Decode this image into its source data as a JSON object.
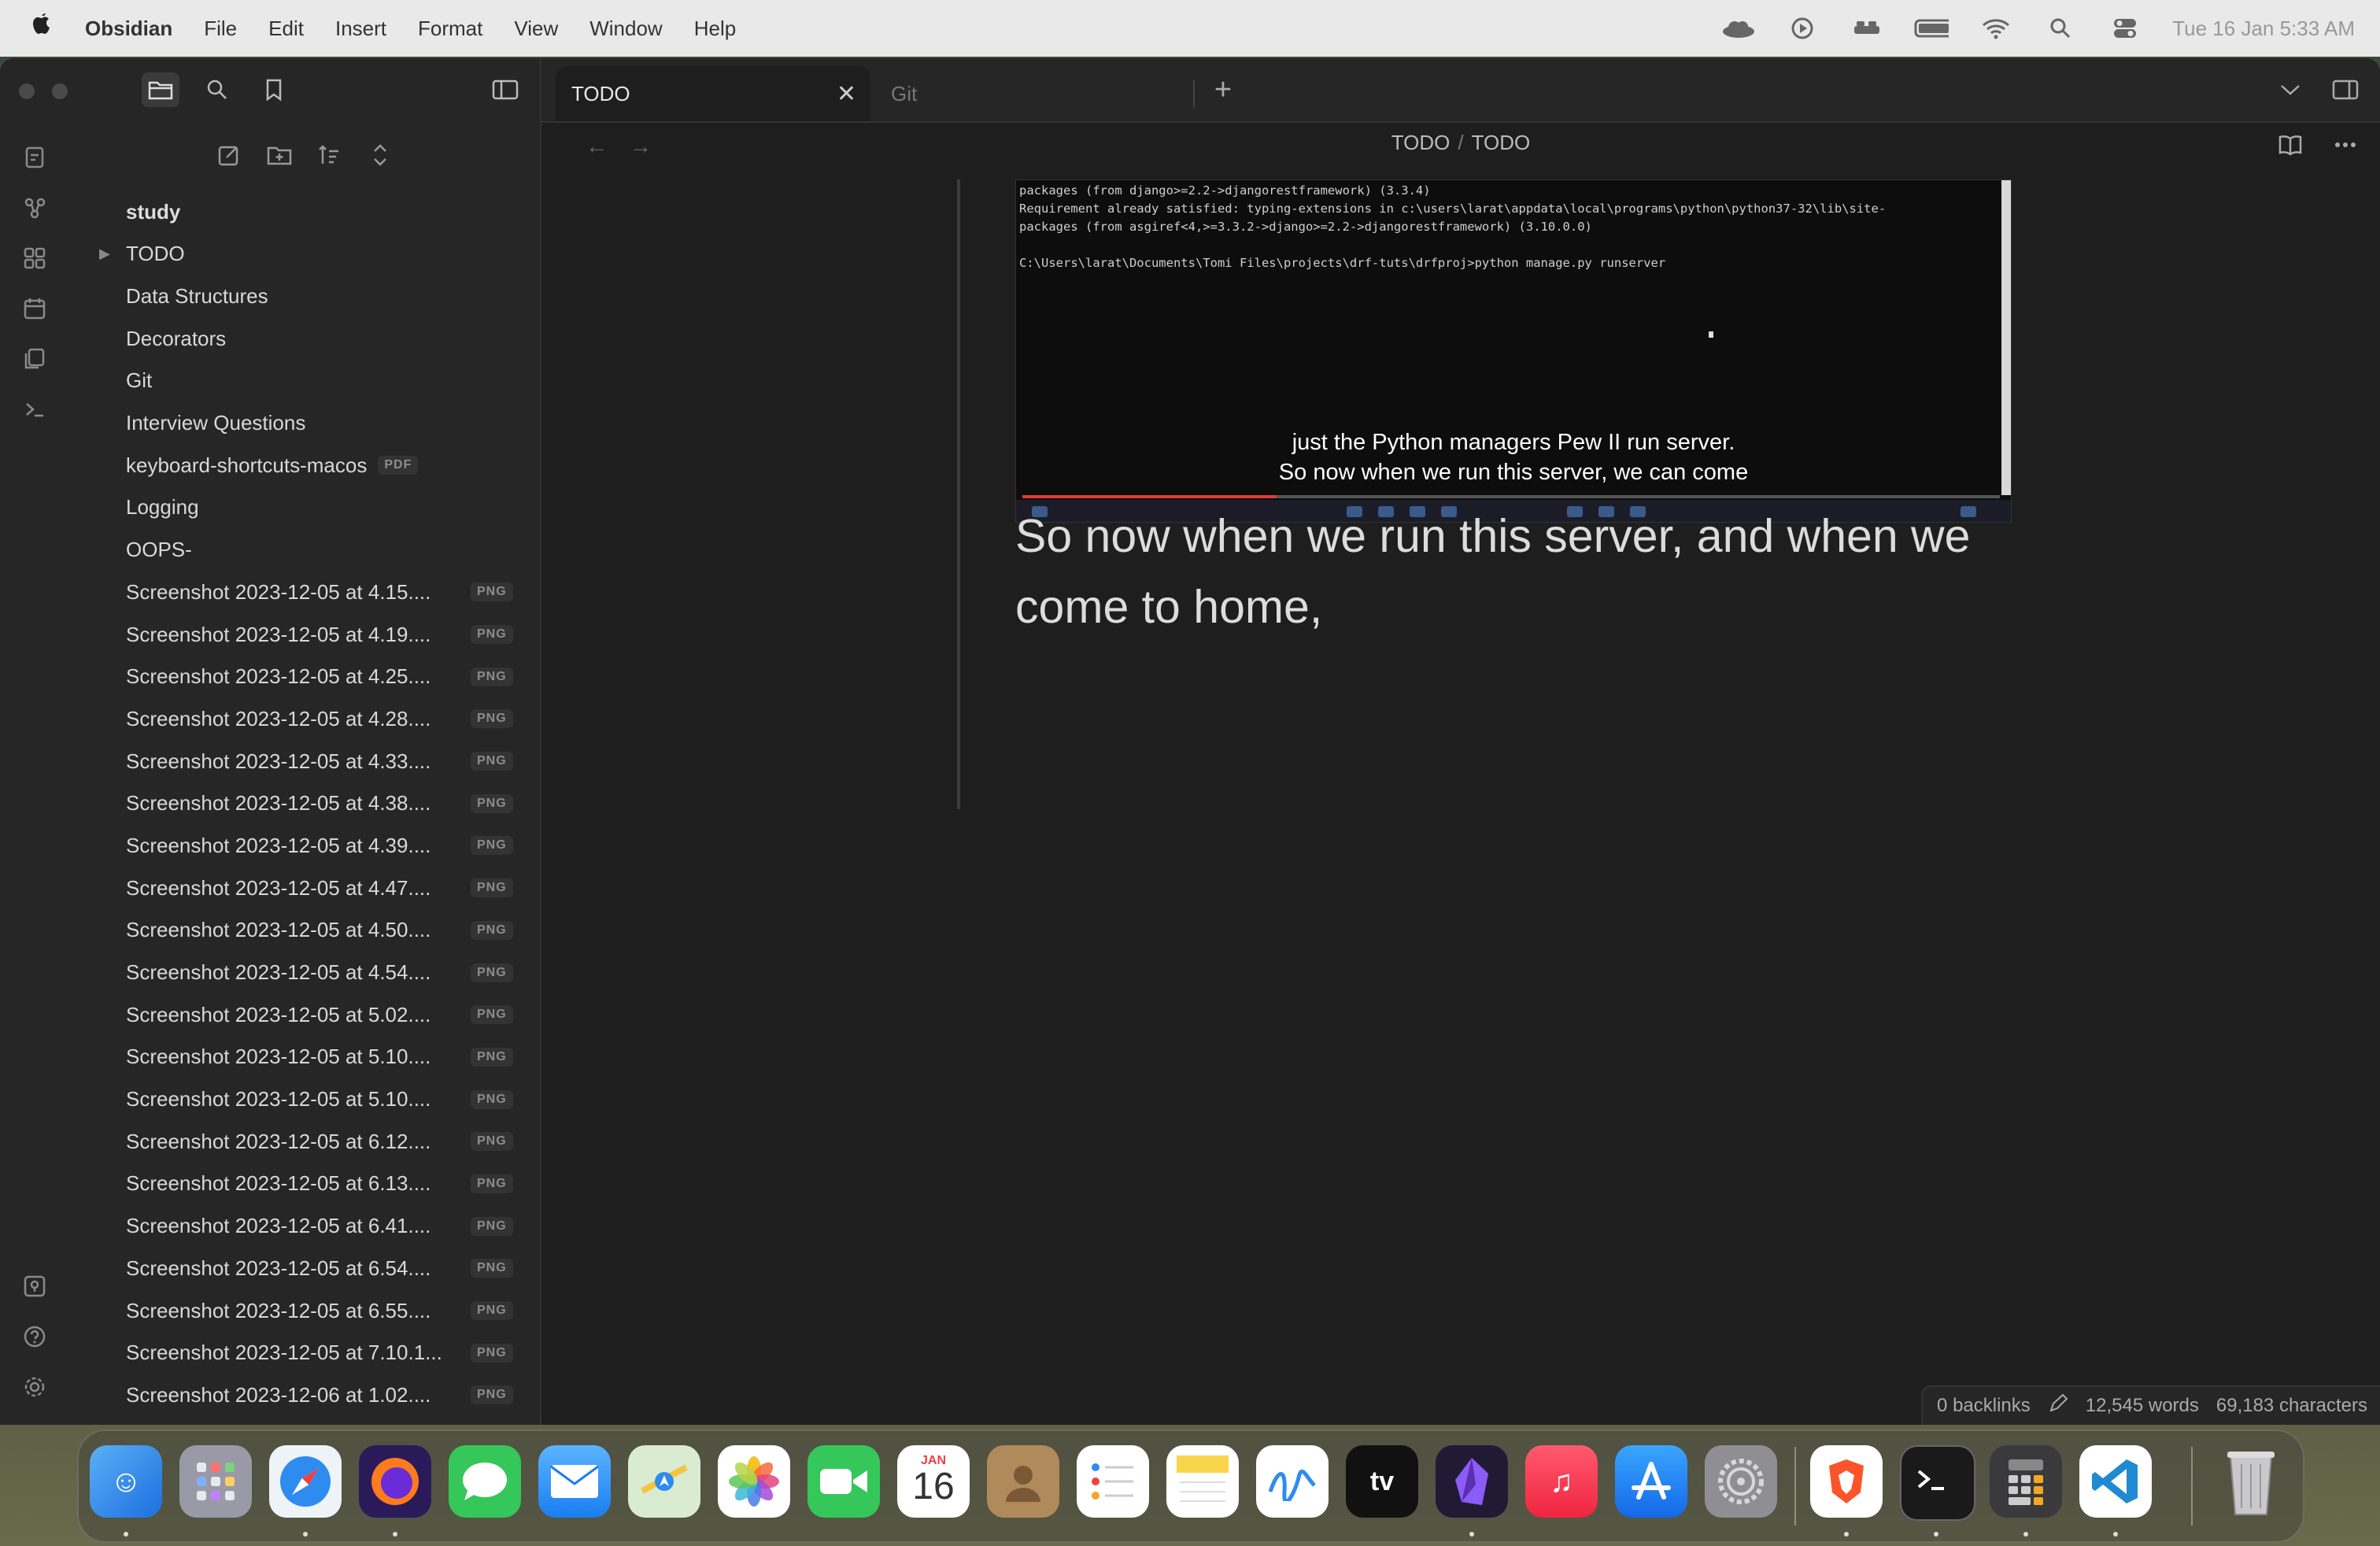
{
  "menubar": {
    "app_name": "Obsidian",
    "menus": [
      "File",
      "Edit",
      "Insert",
      "Format",
      "View",
      "Window",
      "Help"
    ],
    "status_icons": [
      "cloud-icon",
      "play-icon",
      "bed-icon",
      "battery-icon",
      "wifi-icon",
      "search-icon",
      "control-center-icon"
    ],
    "clock": "Tue 16 Jan  5:33 AM"
  },
  "tabs": [
    {
      "label": "TODO",
      "active": true
    },
    {
      "label": "Git",
      "active": false
    }
  ],
  "breadcrumb": {
    "folder": "TODO",
    "sep": "/",
    "file": "TODO"
  },
  "file_tree": {
    "vault": "study",
    "items": [
      {
        "name": "TODO",
        "badge": "",
        "folder": true
      },
      {
        "name": "Data Structures",
        "badge": ""
      },
      {
        "name": "Decorators",
        "badge": ""
      },
      {
        "name": "Git",
        "badge": ""
      },
      {
        "name": "Interview Questions",
        "badge": ""
      },
      {
        "name": "keyboard-shortcuts-macos",
        "badge": "PDF"
      },
      {
        "name": "Logging",
        "badge": ""
      },
      {
        "name": "OOPS-",
        "badge": ""
      },
      {
        "name": "Screenshot 2023-12-05 at 4.15....",
        "badge": "PNG"
      },
      {
        "name": "Screenshot 2023-12-05 at 4.19....",
        "badge": "PNG"
      },
      {
        "name": "Screenshot 2023-12-05 at 4.25....",
        "badge": "PNG"
      },
      {
        "name": "Screenshot 2023-12-05 at 4.28....",
        "badge": "PNG"
      },
      {
        "name": "Screenshot 2023-12-05 at 4.33....",
        "badge": "PNG"
      },
      {
        "name": "Screenshot 2023-12-05 at 4.38....",
        "badge": "PNG"
      },
      {
        "name": "Screenshot 2023-12-05 at 4.39....",
        "badge": "PNG"
      },
      {
        "name": "Screenshot 2023-12-05 at 4.47....",
        "badge": "PNG"
      },
      {
        "name": "Screenshot 2023-12-05 at 4.50....",
        "badge": "PNG"
      },
      {
        "name": "Screenshot 2023-12-05 at 4.54....",
        "badge": "PNG"
      },
      {
        "name": "Screenshot 2023-12-05 at 5.02....",
        "badge": "PNG"
      },
      {
        "name": "Screenshot 2023-12-05 at 5.10....",
        "badge": "PNG"
      },
      {
        "name": "Screenshot 2023-12-05 at 5.10....",
        "badge": "PNG"
      },
      {
        "name": "Screenshot 2023-12-05 at 6.12....",
        "badge": "PNG"
      },
      {
        "name": "Screenshot 2023-12-05 at 6.13....",
        "badge": "PNG"
      },
      {
        "name": "Screenshot 2023-12-05 at 6.41....",
        "badge": "PNG"
      },
      {
        "name": "Screenshot 2023-12-05 at 6.54....",
        "badge": "PNG"
      },
      {
        "name": "Screenshot 2023-12-05 at 6.55....",
        "badge": "PNG"
      },
      {
        "name": "Screenshot 2023-12-05 at 7.10.1...",
        "badge": "PNG"
      },
      {
        "name": "Screenshot 2023-12-06 at 1.02....",
        "badge": "PNG"
      }
    ]
  },
  "embed": {
    "terminal_lines": "packages (from django>=2.2->djangorestframework) (3.3.4)\nRequirement already satisfied: typing-extensions in c:\\users\\larat\\appdata\\local\\programs\\python\\python37-32\\lib\\site-\npackages (from asgiref<4,>=3.3.2->django>=2.2->djangorestframework) (3.10.0.0)\n\nC:\\Users\\larat\\Documents\\Tomi Files\\projects\\drf-tuts\\drfproj>python manage.py runserver",
    "subtitle_line1": "just the Python managers Pew II run server.",
    "subtitle_line2": "So now when we run this server, we can come",
    "video_progress": 0.26
  },
  "note_text": "So now when we run this server, and when we come to home,",
  "statusbar": {
    "backlinks": "0 backlinks",
    "words": "12,545 words",
    "characters": "69,183 characters"
  },
  "dock": {
    "calendar_month": "JAN",
    "calendar_day": "16",
    "apps": [
      "Finder",
      "Launchpad",
      "Safari",
      "Firefox",
      "Messages",
      "Mail",
      "Maps",
      "Photos",
      "FaceTime",
      "Calendar",
      "Contacts",
      "Reminders",
      "Notes",
      "Freeform",
      "TV",
      "Obsidian",
      "Music",
      "App Store",
      "System Settings",
      "Brave",
      "Terminal",
      "Calculator",
      "VS Code",
      "Trash"
    ]
  },
  "colors": {
    "editor_bg": "#1e1e1e",
    "sidebar_bg": "#262626",
    "text": "#dcdcdc",
    "muted": "#8c8c8c"
  }
}
